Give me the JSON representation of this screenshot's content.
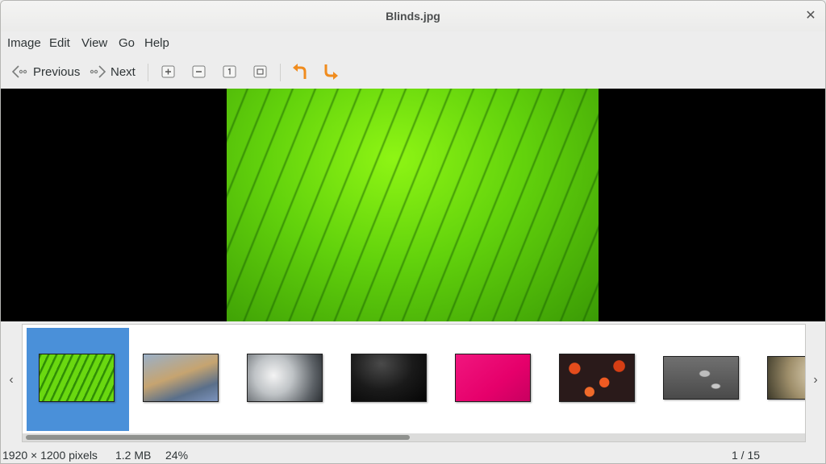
{
  "window": {
    "title": "Blinds.jpg",
    "close_icon": "close-icon"
  },
  "menu": {
    "items": [
      "Image",
      "Edit",
      "View",
      "Go",
      "Help"
    ]
  },
  "toolbar": {
    "previous_label": "Previous",
    "next_label": "Next",
    "icons": {
      "previous": "arrow-left-icon",
      "next": "arrow-right-icon",
      "zoom_in": "zoom-in-icon",
      "zoom_out": "zoom-out-icon",
      "zoom_normal": "zoom-normal-icon",
      "zoom_fit": "zoom-fit-icon",
      "rotate_left": "rotate-left-icon",
      "rotate_right": "rotate-right-icon"
    }
  },
  "gallery": {
    "selected_index": 0,
    "thumbnails": [
      "green leaf",
      "dry grass",
      "dandelion seeds",
      "dark leaves",
      "pink surface",
      "orange flowers",
      "water drops",
      "blurred light"
    ]
  },
  "status": {
    "dimensions": "1920 × 1200 pixels",
    "filesize": "1.2 MB",
    "zoom": "24%",
    "position": "1 / 15"
  },
  "colors": {
    "selection": "#4a90d9",
    "rotate_icons": "#f08c1e"
  }
}
